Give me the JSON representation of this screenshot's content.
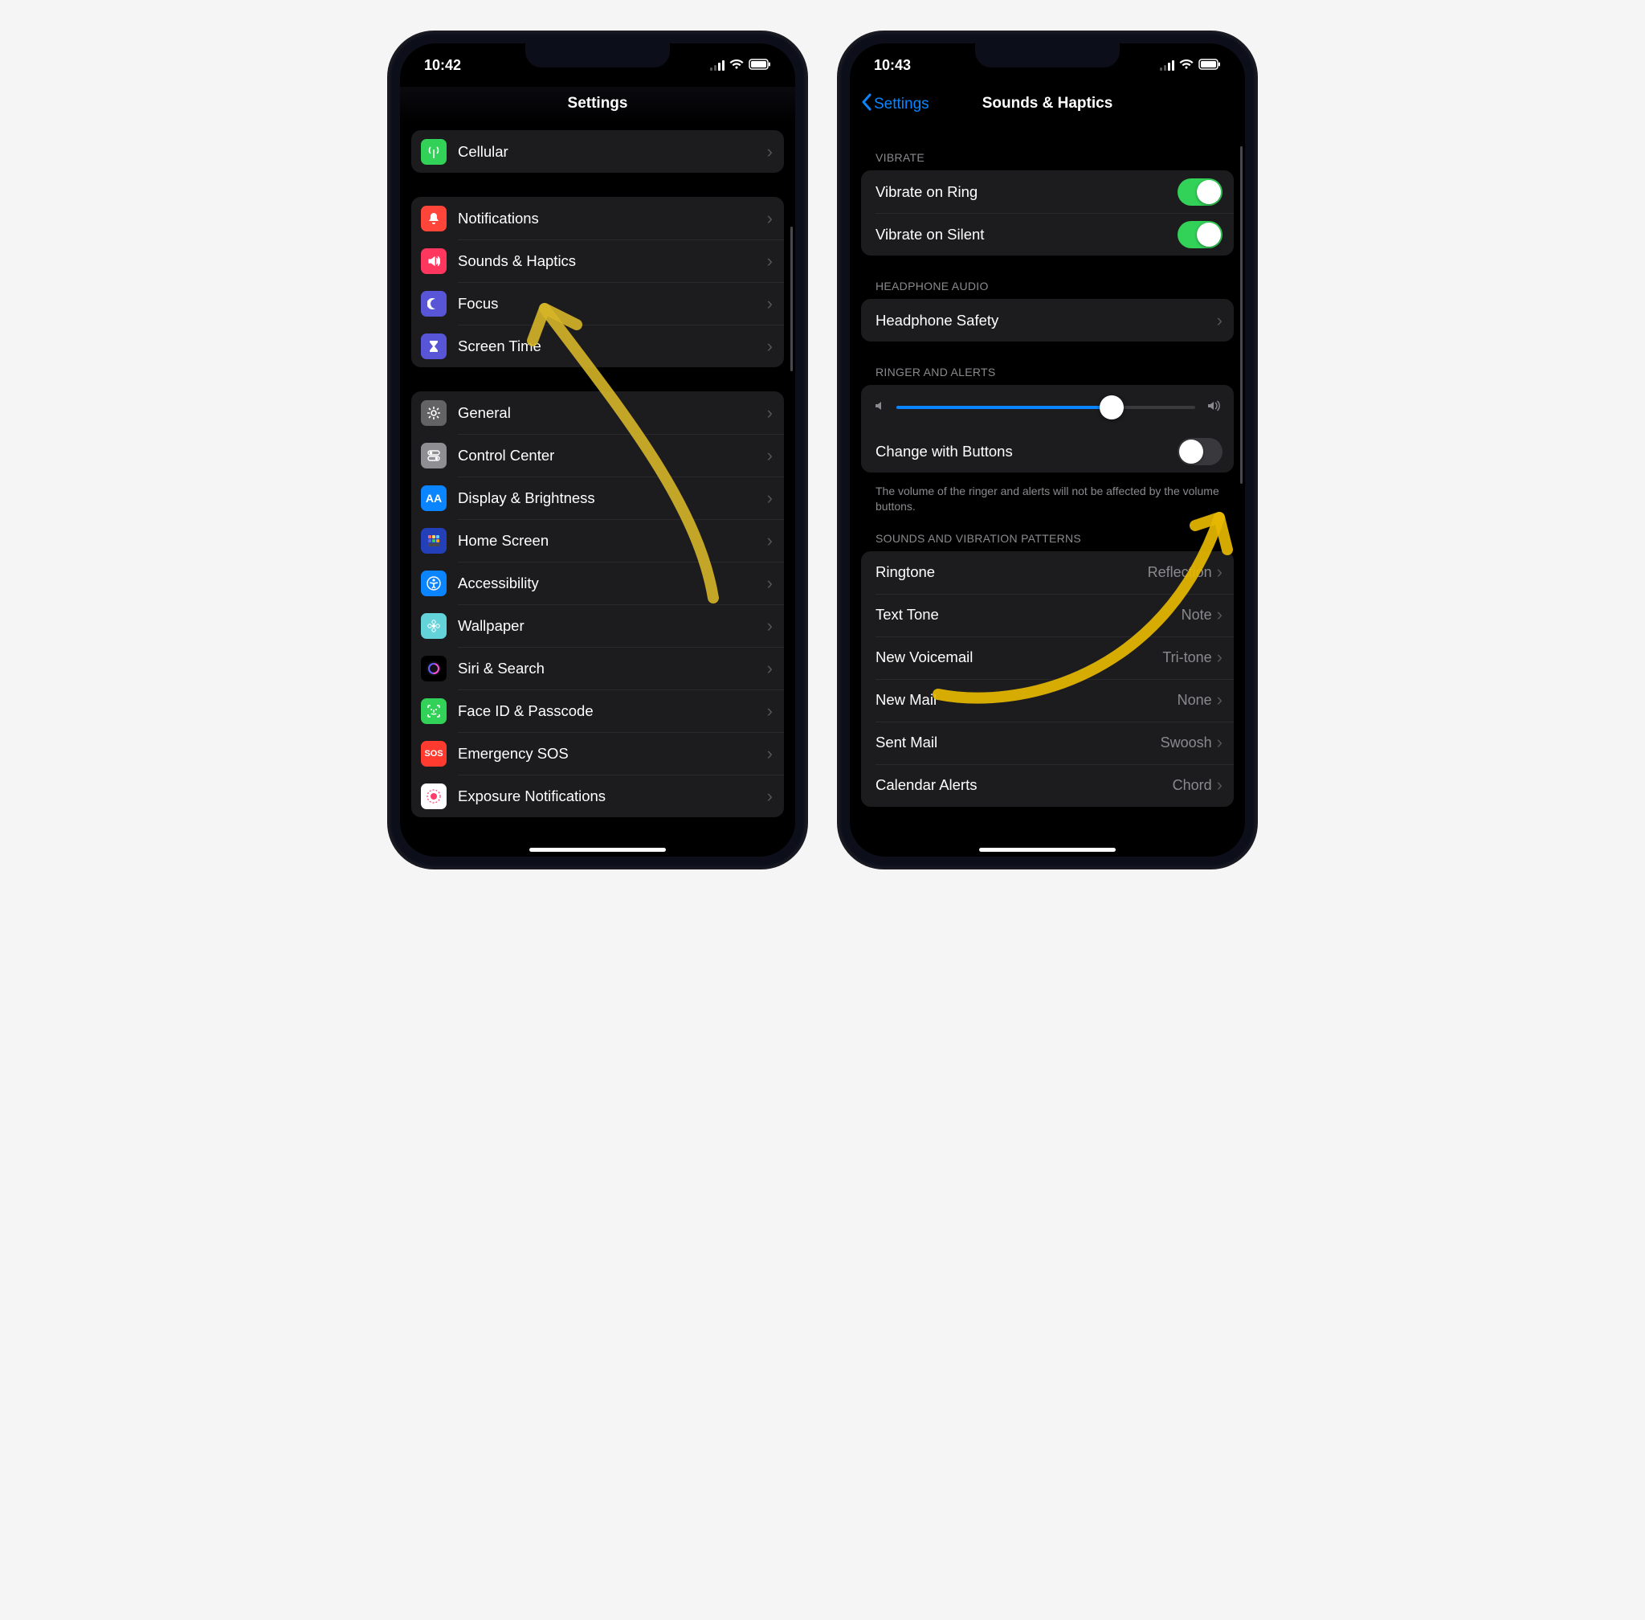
{
  "phone1": {
    "time": "10:42",
    "title": "Settings",
    "groups": {
      "g1": [
        {
          "id": "cellular",
          "label": "Cellular",
          "iconColor": "ic-green",
          "iconName": "antenna-icon"
        }
      ],
      "g2": [
        {
          "id": "notifications",
          "label": "Notifications",
          "iconColor": "ic-red",
          "iconName": "bell-icon"
        },
        {
          "id": "sounds",
          "label": "Sounds & Haptics",
          "iconColor": "ic-pink",
          "iconName": "speaker-icon"
        },
        {
          "id": "focus",
          "label": "Focus",
          "iconColor": "ic-purple",
          "iconName": "moon-icon"
        },
        {
          "id": "screentime",
          "label": "Screen Time",
          "iconColor": "ic-purple",
          "iconName": "hourglass-icon"
        }
      ],
      "g3": [
        {
          "id": "general",
          "label": "General",
          "iconColor": "ic-gray",
          "iconName": "gear-icon"
        },
        {
          "id": "control",
          "label": "Control Center",
          "iconColor": "ic-graylight",
          "iconName": "switches-icon"
        },
        {
          "id": "display",
          "label": "Display & Brightness",
          "iconColor": "ic-blue",
          "iconName": "text-size-icon"
        },
        {
          "id": "home",
          "label": "Home Screen",
          "iconColor": "ic-darkblue",
          "iconName": "grid-icon"
        },
        {
          "id": "accessibility",
          "label": "Accessibility",
          "iconColor": "ic-blue",
          "iconName": "accessibility-icon"
        },
        {
          "id": "wallpaper",
          "label": "Wallpaper",
          "iconColor": "ic-teal",
          "iconName": "flower-icon"
        },
        {
          "id": "siri",
          "label": "Siri & Search",
          "iconColor": "ic-black",
          "iconName": "siri-icon"
        },
        {
          "id": "faceid",
          "label": "Face ID & Passcode",
          "iconColor": "ic-green",
          "iconName": "faceid-icon"
        },
        {
          "id": "sos",
          "label": "Emergency SOS",
          "iconColor": "ic-redsos",
          "iconName": "sos-icon"
        },
        {
          "id": "exposure",
          "label": "Exposure Notifications",
          "iconColor": "ic-pinkex",
          "iconName": "exposure-icon"
        }
      ]
    }
  },
  "phone2": {
    "time": "10:43",
    "back": "Settings",
    "title": "Sounds & Haptics",
    "section_vibrate": "Vibrate",
    "vibrate_ring": "Vibrate on Ring",
    "vibrate_silent": "Vibrate on Silent",
    "section_headphone": "Headphone Audio",
    "headphone_safety": "Headphone Safety",
    "section_ringer": "Ringer and Alerts",
    "change_buttons": "Change with Buttons",
    "footer_ringer": "The volume of the ringer and alerts will not be affected by the volume buttons.",
    "section_sounds": "Sounds and Vibration Patterns",
    "slider_value": 72,
    "patterns": [
      {
        "id": "ringtone",
        "label": "Ringtone",
        "value": "Reflection"
      },
      {
        "id": "texttone",
        "label": "Text Tone",
        "value": "Note"
      },
      {
        "id": "voicemail",
        "label": "New Voicemail",
        "value": "Tri-tone"
      },
      {
        "id": "newmail",
        "label": "New Mail",
        "value": "None"
      },
      {
        "id": "sentmail",
        "label": "Sent Mail",
        "value": "Swoosh"
      },
      {
        "id": "calendar",
        "label": "Calendar Alerts",
        "value": "Chord"
      }
    ]
  }
}
